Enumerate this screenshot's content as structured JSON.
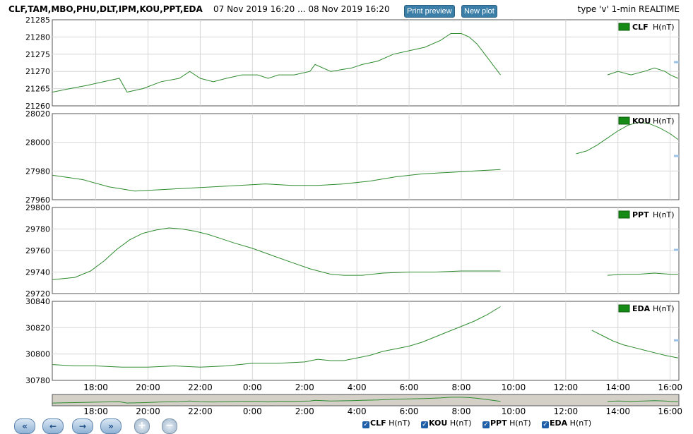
{
  "header": {
    "stations": "CLF,TAM,MBO,PHU,DLT,IPM,KOU,PPT,EDA",
    "range": "07 Nov 2019 16:20 ... 08 Nov 2019 16:20",
    "print_label": "Print preview",
    "newplot_label": "New plot",
    "type_text": "type 'v' 1-min REALTIME"
  },
  "nav": {
    "buttons": [
      "«",
      "←",
      "→",
      "»"
    ],
    "zoom_in": "+",
    "zoom_out": "−",
    "legend": [
      {
        "code": "CLF",
        "unit": "H(nT)"
      },
      {
        "code": "KOU",
        "unit": "H(nT)"
      },
      {
        "code": "PPT",
        "unit": "H(nT)"
      },
      {
        "code": "EDA",
        "unit": "H(nT)"
      }
    ]
  },
  "chart_data": {
    "type": "line",
    "x_ticks": [
      "18:00",
      "20:00",
      "22:00",
      "0:00",
      "2:00",
      "4:00",
      "6:00",
      "8:00",
      "10:00",
      "12:00",
      "14:00",
      "16:00"
    ],
    "x_range_hours": [
      16.3333,
      40.3333
    ],
    "x_tick_hours": [
      18,
      20,
      22,
      24,
      26,
      28,
      30,
      32,
      34,
      36,
      38,
      40
    ],
    "line_color": "#2e8b2e",
    "grid": true,
    "panels": [
      {
        "station": "CLF",
        "unit": "H(nT)",
        "ylim": [
          21260,
          21285
        ],
        "yticks": [
          21260,
          21265,
          21270,
          21275,
          21280,
          21285
        ],
        "segments": [
          {
            "x": [
              16.35,
              17.0,
              17.7,
              18.3,
              18.9,
              19.2,
              19.8,
              20.5,
              21.2,
              21.6,
              22.0,
              22.5,
              23.0,
              23.6,
              24.2,
              24.6,
              25.0,
              25.6,
              26.2,
              26.4,
              27.0,
              27.8,
              28.2,
              28.8,
              29.4,
              30.0,
              30.6,
              31.2,
              31.6,
              32.0,
              32.3,
              32.6,
              33.0,
              33.5
            ],
            "y": [
              21264,
              21265,
              21266,
              21267,
              21268,
              21264,
              21265,
              21267,
              21268,
              21270,
              21268,
              21267,
              21268,
              21269,
              21269,
              21268,
              21269,
              21269,
              21270,
              21272,
              21270,
              21271,
              21272,
              21273,
              21275,
              21276,
              21277,
              21279,
              21281,
              21281,
              21280,
              21278,
              21274,
              21269
            ]
          },
          {
            "x": [
              37.6,
              38.0,
              38.5,
              39.0,
              39.4,
              39.8,
              40.0,
              40.3
            ],
            "y": [
              21269,
              21270,
              21269,
              21270,
              21271,
              21270,
              21269,
              21268
            ]
          }
        ]
      },
      {
        "station": "KOU",
        "unit": "H(nT)",
        "ylim": [
          27960,
          28020
        ],
        "yticks": [
          27960,
          27980,
          28000,
          28020
        ],
        "segments": [
          {
            "x": [
              16.35,
              17.5,
              18.5,
              19.5,
              20.5,
              21.5,
              22.5,
              23.5,
              24.5,
              25.5,
              26.5,
              27.5,
              28.5,
              29.5,
              30.5,
              31.5,
              32.5,
              33.5
            ],
            "y": [
              27977,
              27974,
              27969,
              27966,
              27967,
              27968,
              27969,
              27970,
              27971,
              27970,
              27970,
              27971,
              27973,
              27976,
              27978,
              27979,
              27980,
              27981
            ]
          },
          {
            "x": [
              36.4,
              36.8,
              37.2,
              37.6,
              38.0,
              38.4,
              38.8,
              39.2,
              39.6,
              40.0,
              40.3
            ],
            "y": [
              27992,
              27994,
              27998,
              28003,
              28008,
              28012,
              28014,
              28013,
              28010,
              28006,
              28002
            ]
          }
        ]
      },
      {
        "station": "PPT",
        "unit": "H(nT)",
        "ylim": [
          29720,
          29800
        ],
        "yticks": [
          29720,
          29740,
          29760,
          29780,
          29800
        ],
        "segments": [
          {
            "x": [
              16.35,
              17.2,
              17.8,
              18.3,
              18.8,
              19.3,
              19.8,
              20.3,
              20.8,
              21.3,
              21.8,
              22.3,
              22.8,
              23.3,
              24.0,
              24.8,
              25.5,
              26.2,
              27.0,
              27.5,
              28.2,
              29.0,
              30.0,
              31.0,
              32.0,
              33.0,
              33.5
            ],
            "y": [
              29733,
              29735,
              29741,
              29750,
              29761,
              29770,
              29776,
              29779,
              29781,
              29780,
              29778,
              29775,
              29771,
              29767,
              29762,
              29755,
              29749,
              29743,
              29738,
              29737,
              29737,
              29739,
              29740,
              29740,
              29741,
              29741,
              29741
            ]
          },
          {
            "x": [
              37.6,
              38.2,
              38.8,
              39.4,
              40.0,
              40.3
            ],
            "y": [
              29737,
              29738,
              29738,
              29739,
              29738,
              29738
            ]
          }
        ]
      },
      {
        "station": "EDA",
        "unit": "H(nT)",
        "ylim": [
          30780,
          30840
        ],
        "yticks": [
          30780,
          30800,
          30820,
          30840
        ],
        "segments": [
          {
            "x": [
              16.35,
              17.2,
              18.0,
              19.0,
              20.0,
              21.0,
              22.0,
              23.0,
              24.0,
              25.0,
              26.0,
              26.5,
              27.0,
              27.5,
              28.0,
              28.5,
              29.0,
              29.5,
              30.0,
              30.5,
              31.0,
              31.5,
              32.0,
              32.5,
              33.0,
              33.5
            ],
            "y": [
              30792,
              30791,
              30791,
              30790,
              30790,
              30791,
              30790,
              30791,
              30793,
              30793,
              30794,
              30796,
              30795,
              30795,
              30797,
              30799,
              30802,
              30804,
              30806,
              30809,
              30813,
              30817,
              30821,
              30825,
              30830,
              30836
            ]
          },
          {
            "x": [
              37.0,
              37.4,
              37.8,
              38.2,
              38.6,
              39.0,
              39.4,
              39.8,
              40.3
            ],
            "y": [
              30818,
              30814,
              30810,
              30807,
              30805,
              30803,
              30801,
              30799,
              30797
            ]
          }
        ]
      }
    ]
  }
}
